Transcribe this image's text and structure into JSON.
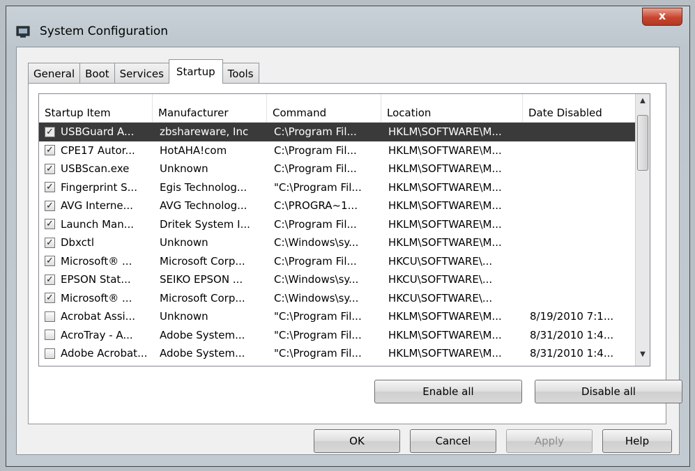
{
  "window": {
    "title": "System Configuration",
    "close_label": "x"
  },
  "tabs": [
    {
      "label": "General"
    },
    {
      "label": "Boot"
    },
    {
      "label": "Services"
    },
    {
      "label": "Startup",
      "active": true
    },
    {
      "label": "Tools"
    }
  ],
  "columns": [
    "Startup Item",
    "Manufacturer",
    "Command",
    "Location",
    "Date Disabled"
  ],
  "rows": [
    {
      "checked": true,
      "item": "USBGuard A...",
      "manufacturer": "zbshareware, Inc",
      "command": "C:\\Program Fil...",
      "location": "HKLM\\SOFTWARE\\M...",
      "date": "",
      "selected": true
    },
    {
      "checked": true,
      "item": "CPE17 Autor...",
      "manufacturer": "HotAHA!com",
      "command": "C:\\Program Fil...",
      "location": "HKLM\\SOFTWARE\\M...",
      "date": ""
    },
    {
      "checked": true,
      "item": "USBScan.exe",
      "manufacturer": "Unknown",
      "command": "C:\\Program Fil...",
      "location": "HKLM\\SOFTWARE\\M...",
      "date": ""
    },
    {
      "checked": true,
      "item": "Fingerprint S...",
      "manufacturer": "Egis Technolog...",
      "command": "\"C:\\Program Fil...",
      "location": "HKLM\\SOFTWARE\\M...",
      "date": ""
    },
    {
      "checked": true,
      "item": "AVG Interne...",
      "manufacturer": "AVG Technolog...",
      "command": "C:\\PROGRA~1...",
      "location": "HKLM\\SOFTWARE\\M...",
      "date": ""
    },
    {
      "checked": true,
      "item": "Launch Man...",
      "manufacturer": "Dritek System I...",
      "command": "C:\\Program Fil...",
      "location": "HKLM\\SOFTWARE\\M...",
      "date": ""
    },
    {
      "checked": true,
      "item": "Dbxctl",
      "manufacturer": "Unknown",
      "command": "C:\\Windows\\sy...",
      "location": "HKLM\\SOFTWARE\\M...",
      "date": ""
    },
    {
      "checked": true,
      "item": "Microsoft® ...",
      "manufacturer": "Microsoft Corp...",
      "command": "C:\\Program Fil...",
      "location": "HKCU\\SOFTWARE\\...",
      "date": ""
    },
    {
      "checked": true,
      "item": "EPSON Stat...",
      "manufacturer": "SEIKO EPSON ...",
      "command": "C:\\Windows\\sy...",
      "location": "HKCU\\SOFTWARE\\...",
      "date": ""
    },
    {
      "checked": true,
      "item": "Microsoft® ...",
      "manufacturer": "Microsoft Corp...",
      "command": "C:\\Windows\\sy...",
      "location": "HKCU\\SOFTWARE\\...",
      "date": ""
    },
    {
      "checked": false,
      "item": "Acrobat Assi...",
      "manufacturer": "Unknown",
      "command": "\"C:\\Program Fil...",
      "location": "HKLM\\SOFTWARE\\M...",
      "date": "8/19/2010 7:1..."
    },
    {
      "checked": false,
      "item": "AcroTray - A...",
      "manufacturer": "Adobe System...",
      "command": "\"C:\\Program Fil...",
      "location": "HKLM\\SOFTWARE\\M...",
      "date": "8/31/2010 1:4..."
    },
    {
      "checked": false,
      "item": "Adobe Acrobat...",
      "manufacturer": "Adobe System...",
      "command": "\"C:\\Program Fil...",
      "location": "HKLM\\SOFTWARE\\M...",
      "date": "8/31/2010 1:4..."
    }
  ],
  "buttons": {
    "enable_all": "Enable all",
    "disable_all": "Disable all",
    "ok": "OK",
    "cancel": "Cancel",
    "apply": "Apply",
    "help": "Help"
  },
  "colors": {
    "selection": "#3a3a3a",
    "close": "#c8452f"
  }
}
